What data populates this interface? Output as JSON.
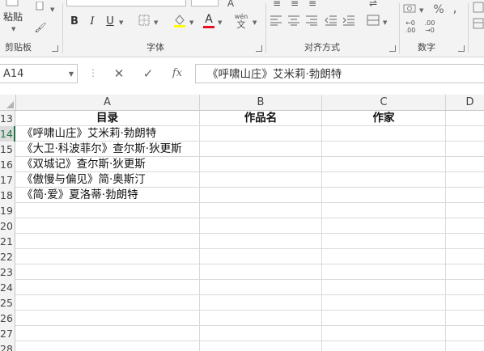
{
  "ribbon": {
    "clipboard": {
      "paste_label": "粘贴",
      "group_label": "剪贴板"
    },
    "font": {
      "group_label": "字体",
      "bold": "B",
      "italic": "I",
      "underline": "U",
      "font_color_glyph": "A",
      "phonetic_glyph": "wén",
      "phonetic_sub": "文"
    },
    "alignment": {
      "group_label": "对齐方式"
    },
    "number": {
      "group_label": "数字",
      "percent": "%",
      "inc_decimal": "←0\n.00",
      "dec_decimal": ".00\n→0"
    }
  },
  "formula_bar": {
    "name_box": "A14",
    "fx_label": "fx",
    "content": "《呼啸山庄》艾米莉·勃朗特"
  },
  "sheet": {
    "columns": [
      "A",
      "B",
      "C",
      "D"
    ],
    "selected_row": "14",
    "rows": [
      {
        "num": "13",
        "cells": [
          "目录",
          "作品名",
          "作家"
        ],
        "header": true
      },
      {
        "num": "14",
        "cells": [
          "《呼啸山庄》艾米莉·勃朗特",
          "",
          ""
        ]
      },
      {
        "num": "15",
        "cells": [
          "《大卫·科波菲尔》查尔斯·狄更斯",
          "",
          ""
        ]
      },
      {
        "num": "16",
        "cells": [
          "《双城记》查尔斯·狄更斯",
          "",
          ""
        ]
      },
      {
        "num": "17",
        "cells": [
          "《傲慢与偏见》简·奥斯汀",
          "",
          ""
        ]
      },
      {
        "num": "18",
        "cells": [
          "《简·爱》夏洛蒂·勃朗特",
          "",
          ""
        ]
      },
      {
        "num": "19",
        "cells": [
          "",
          "",
          ""
        ]
      },
      {
        "num": "20",
        "cells": [
          "",
          "",
          ""
        ]
      },
      {
        "num": "21",
        "cells": [
          "",
          "",
          ""
        ]
      },
      {
        "num": "22",
        "cells": [
          "",
          "",
          ""
        ]
      },
      {
        "num": "23",
        "cells": [
          "",
          "",
          ""
        ]
      },
      {
        "num": "24",
        "cells": [
          "",
          "",
          ""
        ]
      },
      {
        "num": "25",
        "cells": [
          "",
          "",
          ""
        ]
      },
      {
        "num": "26",
        "cells": [
          "",
          "",
          ""
        ]
      },
      {
        "num": "27",
        "cells": [
          "",
          "",
          ""
        ]
      },
      {
        "num": "28",
        "cells": [
          "",
          "",
          ""
        ]
      }
    ]
  },
  "colors": {
    "accent": "#217346",
    "ribbon_bg": "#f3f3f3",
    "font_color_bar": "#e81123"
  }
}
